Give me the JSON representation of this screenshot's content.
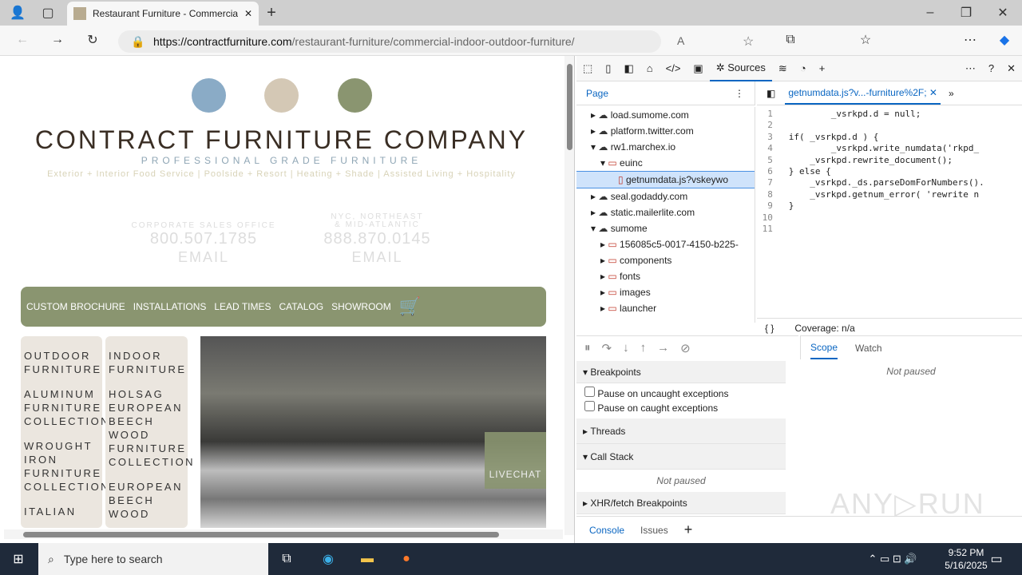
{
  "browser": {
    "tab_title": "Restaurant Furniture - Commercial",
    "url_domain": "https://contractfurniture.com",
    "url_path": "/restaurant-furniture/commercial-indoor-outdoor-furniture/"
  },
  "site": {
    "company": "CONTRACT FURNITURE COMPANY",
    "subtitle": "PROFESSIONAL GRADE FURNITURE",
    "tagline": "Exterior + Interior Food Service | Poolside + Resort | Heating + Shade | Assisted Living + Hospitality",
    "office1": {
      "label": "CORPORATE SALES OFFICE",
      "phone": "800.507.1785",
      "email": "EMAIL"
    },
    "office2": {
      "label1": "NYC, NORTHEAST",
      "label2": "& MID-ATLANTIC",
      "phone": "888.870.0145",
      "email": "EMAIL"
    },
    "nav": [
      "CUSTOM BROCHURE",
      "INSTALLATIONS",
      "LEAD TIMES",
      "CATALOG",
      "SHOWROOM"
    ],
    "col1": [
      "OUTDOOR FURNITURE",
      "ALUMINUM FURNITURE COLLECTIONS",
      "WROUGHT IRON FURNITURE COLLECTIONS",
      "ITALIAN"
    ],
    "col2": [
      "INDOOR FURNITURE",
      "HOLSAG EUROPEAN BEECH WOOD FURNITURE COLLECTION",
      "EUROPEAN BEECH WOOD"
    ],
    "livechat": "LIVECHAT"
  },
  "devtools": {
    "sources_tab": "Sources",
    "page_tab": "Page",
    "file_tab": "getnumdata.js?v...-furniture%2F;",
    "tree": [
      {
        "label": "load.sumome.com",
        "type": "domain",
        "depth": 0
      },
      {
        "label": "platform.twitter.com",
        "type": "domain",
        "depth": 0
      },
      {
        "label": "rw1.marchex.io",
        "type": "domain",
        "depth": 0,
        "open": true
      },
      {
        "label": "euinc",
        "type": "folder",
        "depth": 1,
        "open": true
      },
      {
        "label": "getnumdata.js?vskeywo",
        "type": "file",
        "depth": 2
      },
      {
        "label": "seal.godaddy.com",
        "type": "domain",
        "depth": 0
      },
      {
        "label": "static.mailerlite.com",
        "type": "domain",
        "depth": 0
      },
      {
        "label": "sumome",
        "type": "domain",
        "depth": 0,
        "open": true
      },
      {
        "label": "156085c5-0017-4150-b225-",
        "type": "folder",
        "depth": 1
      },
      {
        "label": "components",
        "type": "folder",
        "depth": 1
      },
      {
        "label": "fonts",
        "type": "folder",
        "depth": 1
      },
      {
        "label": "images",
        "type": "folder",
        "depth": 1
      },
      {
        "label": "launcher",
        "type": "folder",
        "depth": 1
      }
    ],
    "code": [
      "        _vsrkpd.d = null;",
      "",
      "if( _vsrkpd.d ) {",
      "        _vsrkpd.write_numdata('rkpd_",
      "    _vsrkpd.rewrite_document();",
      "} else {",
      "    _vsrkpd._ds.parseDomForNumbers().",
      "    _vsrkpd.getnum_error( 'rewrite n",
      "}",
      "",
      ""
    ],
    "coverage": "Coverage: n/a",
    "braces": "{ }",
    "breakpoints": "Breakpoints",
    "pause_uncaught": "Pause on uncaught exceptions",
    "pause_caught": "Pause on caught exceptions",
    "threads": "Threads",
    "call_stack": "Call Stack",
    "not_paused": "Not paused",
    "xhr": "XHR/fetch Breakpoints",
    "scope": "Scope",
    "watch": "Watch",
    "console": "Console",
    "issues": "Issues"
  },
  "taskbar": {
    "search_placeholder": "Type here to search",
    "time": "9:52 PM",
    "date": "5/16/2025"
  }
}
